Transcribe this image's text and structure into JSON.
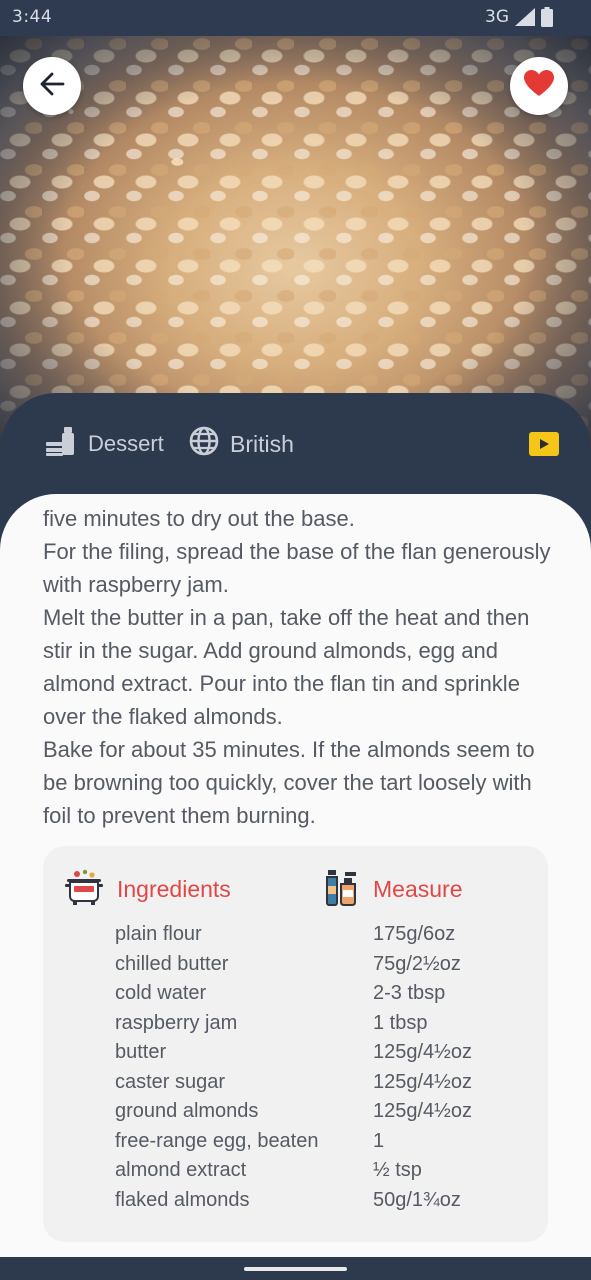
{
  "status_bar": {
    "time": "3:44",
    "network": "3G"
  },
  "recipe": {
    "category": "Dessert",
    "area": "British",
    "instructions": "five minutes to dry out the base.\nFor the filing, spread the base of the flan generously with raspberry jam.\nMelt the butter in a pan, take off the heat and then stir in the sugar. Add ground almonds, egg and almond extract. Pour into the flan tin and sprinkle over the flaked almonds.\nBake for about 35 minutes. If the almonds seem to be browning too quickly, cover the tart loosely with foil to prevent them burning."
  },
  "table": {
    "ingredients_title": "Ingredients",
    "measure_title": "Measure",
    "rows": [
      {
        "ingredient": "plain flour",
        "measure": "175g/6oz"
      },
      {
        "ingredient": "chilled butter",
        "measure": "75g/2½oz"
      },
      {
        "ingredient": "cold water",
        "measure": "2-3 tbsp"
      },
      {
        "ingredient": "raspberry jam",
        "measure": "1 tbsp"
      },
      {
        "ingredient": "butter",
        "measure": "125g/4½oz"
      },
      {
        "ingredient": "caster sugar",
        "measure": "125g/4½oz"
      },
      {
        "ingredient": "ground almonds",
        "measure": "125g/4½oz"
      },
      {
        "ingredient": "free-range egg, beaten",
        "measure": "1"
      },
      {
        "ingredient": "almond extract",
        "measure": "½ tsp"
      },
      {
        "ingredient": "flaked almonds",
        "measure": "50g/1¾oz"
      }
    ]
  },
  "icons": {
    "back": "arrow-left-icon",
    "favorite": "heart-icon",
    "category": "food-service-icon",
    "area": "globe-icon",
    "video": "play-icon",
    "ingredients": "cooking-pot-icon",
    "measure": "bottles-icon"
  },
  "colors": {
    "accent": "#e04848",
    "favorite": "#e53935",
    "video": "#f5c518",
    "panel": "#2d3a4e"
  }
}
